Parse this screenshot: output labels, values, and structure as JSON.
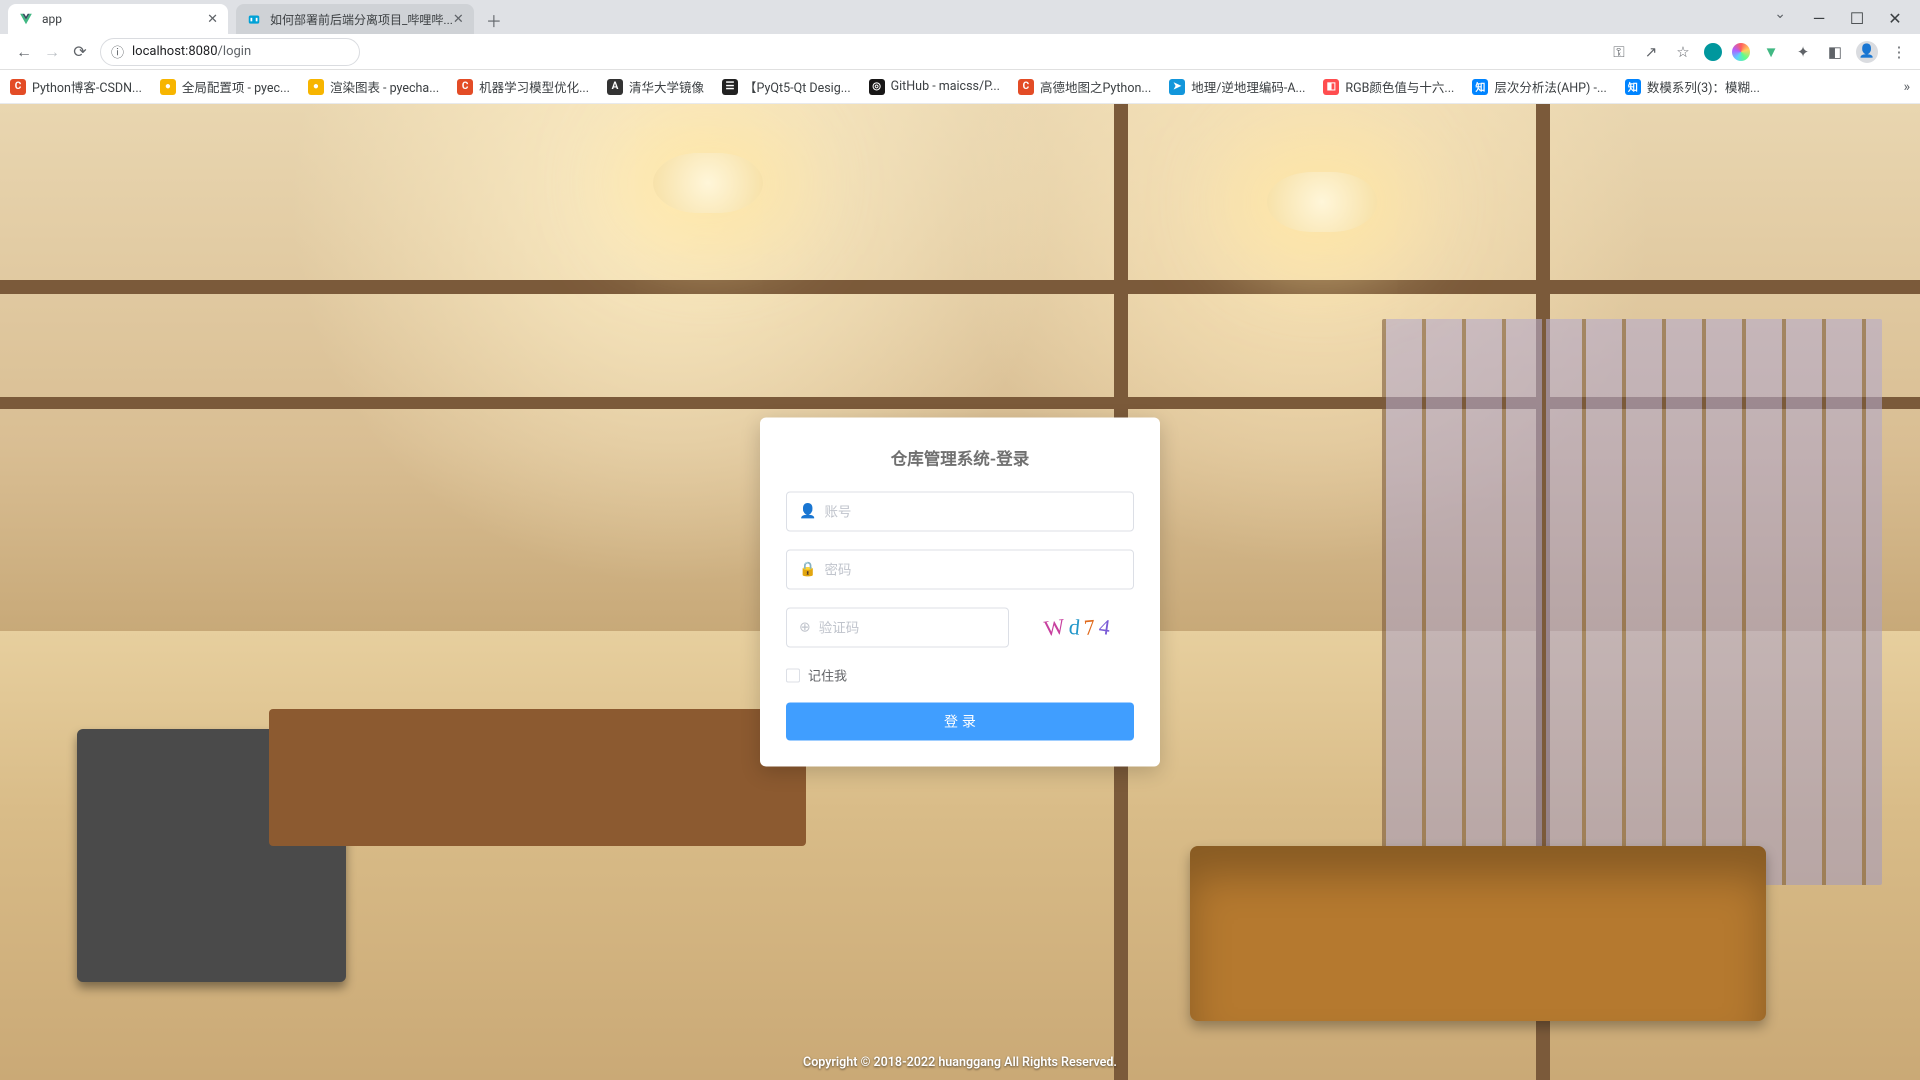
{
  "browser": {
    "tabs": [
      {
        "title": "app",
        "favicon_color": "#41b883"
      },
      {
        "title": "如何部署前后端分离项目_哔哩哔...",
        "favicon_color": "#00a1d6"
      }
    ],
    "url_host": "localhost:8080",
    "url_path": "/login",
    "info_icon_label": "ⓘ"
  },
  "bookmarks": [
    {
      "label": "Python博客-CSDN...",
      "bg": "#e34c26",
      "ch": "C"
    },
    {
      "label": "全局配置项 - pyec...",
      "bg": "#f7b500",
      "ch": "●"
    },
    {
      "label": "渲染图表 - pyecha...",
      "bg": "#f7b500",
      "ch": "●"
    },
    {
      "label": "机器学习模型优化...",
      "bg": "#e34c26",
      "ch": "C"
    },
    {
      "label": "清华大学镜像",
      "bg": "#333333",
      "ch": "A"
    },
    {
      "label": "【PyQt5-Qt Desig...",
      "bg": "#222222",
      "ch": "☰"
    },
    {
      "label": "GitHub - maicss/P...",
      "bg": "#181717",
      "ch": "◎"
    },
    {
      "label": "高德地图之Python...",
      "bg": "#e34c26",
      "ch": "C"
    },
    {
      "label": "地理/逆地理编码-A...",
      "bg": "#1296db",
      "ch": "➤"
    },
    {
      "label": "RGB颜色值与十六...",
      "bg": "#ff4d4f",
      "ch": "◧"
    },
    {
      "label": "层次分析法(AHP) -...",
      "bg": "#0084ff",
      "ch": "知"
    },
    {
      "label": "数模系列(3)：模糊...",
      "bg": "#0084ff",
      "ch": "知"
    }
  ],
  "login": {
    "title": "仓库管理系统-登录",
    "username_placeholder": "账号",
    "password_placeholder": "密码",
    "captcha_placeholder": "验证码",
    "captcha_text": "Wd74",
    "remember_label": "记住我",
    "submit_label": "登 录"
  },
  "footer": "Copyright © 2018-2022 huanggang All Rights Reserved."
}
